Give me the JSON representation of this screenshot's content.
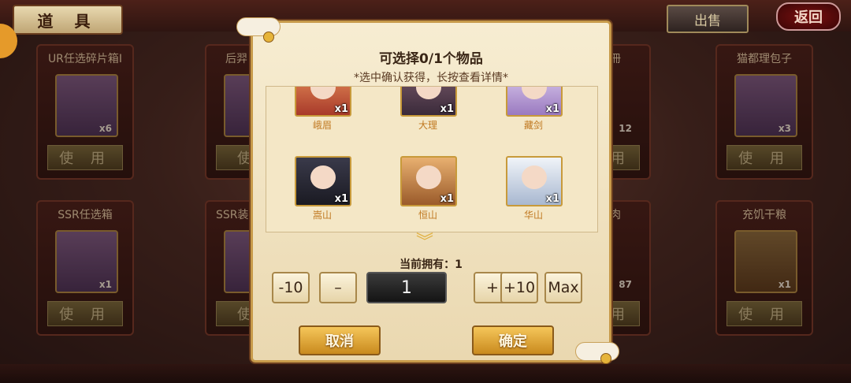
{
  "header": {
    "title": "道 具",
    "sell_label": "出售",
    "back_label": "返回"
  },
  "cards": [
    {
      "name": "UR任选碎片箱I",
      "count": "x6",
      "use": "使 用"
    },
    {
      "name": "后羿",
      "count": "",
      "use": "使"
    },
    {
      "name": "猫都理包子",
      "count": "x3",
      "use": "使 用"
    },
    {
      "name": "SSR任选箱",
      "count": "x1",
      "use": "使 用"
    },
    {
      "name": "SSR装",
      "count": "",
      "use": "使"
    },
    {
      "name": "充饥干粮",
      "count": "x1",
      "use": "使 用"
    }
  ],
  "partial_labels": {
    "right_top": "12",
    "right_bottom": "87",
    "right_top_name": "冊",
    "right_bottom_name": "肉",
    "right_use": "用"
  },
  "modal": {
    "title": "可选择0/1个物品",
    "hint": "*选中确认获得，长按查看详情*",
    "heroes": [
      {
        "name": "峨眉",
        "qty": "x1",
        "color": "#c8533a"
      },
      {
        "name": "大理",
        "qty": "x1",
        "color": "#5a3a5a"
      },
      {
        "name": "藏剑",
        "qty": "x1",
        "color": "#b89ad8"
      },
      {
        "name": "嵩山",
        "qty": "x1",
        "color": "#3a2a3a"
      },
      {
        "name": "恒山",
        "qty": "x1",
        "color": "#c88a4a"
      },
      {
        "name": "华山",
        "qty": "x1",
        "color": "#c8d8e8"
      },
      {
        "name": "",
        "qty": "",
        "color": "#4a6a7a"
      },
      {
        "name": "",
        "qty": "",
        "color": "#d8b070"
      }
    ],
    "owned": "当前拥有：1",
    "controls": {
      "minus10": "-10",
      "minus": "–",
      "value": "1",
      "plus": "+",
      "plus10": "+10",
      "max": "Max"
    },
    "cancel": "取消",
    "confirm": "确定"
  }
}
